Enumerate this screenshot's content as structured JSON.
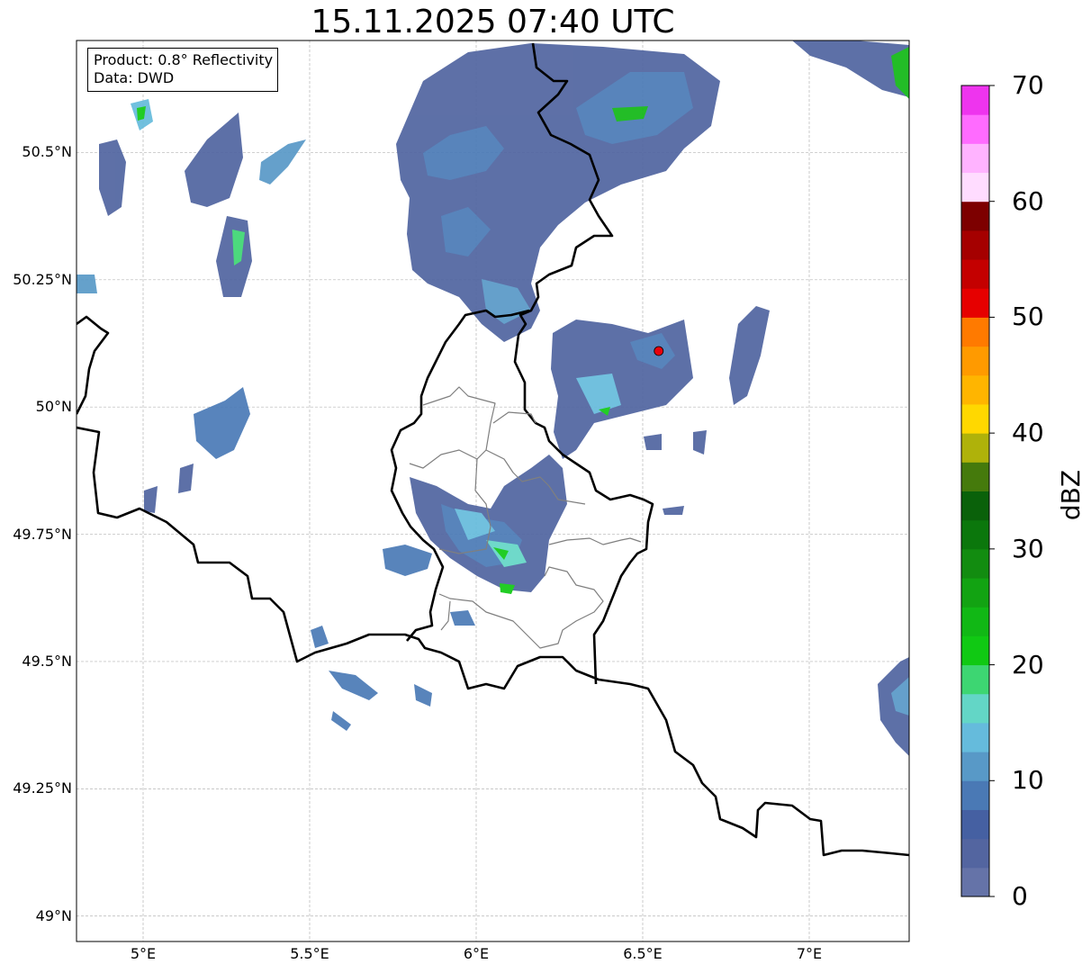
{
  "title": "15.11.2025 07:40 UTC",
  "info_box": {
    "product": "Product: 0.8° Reflectivity",
    "data": "Data: DWD"
  },
  "map": {
    "lon_range": [
      4.8,
      7.3
    ],
    "lat_range": [
      48.95,
      50.72
    ],
    "lat_ticks": [
      {
        "value": 49.0,
        "label": "49°N"
      },
      {
        "value": 49.25,
        "label": "49.25°N"
      },
      {
        "value": 49.5,
        "label": "49.5°N"
      },
      {
        "value": 49.75,
        "label": "49.75°N"
      },
      {
        "value": 50.0,
        "label": "50°N"
      },
      {
        "value": 50.25,
        "label": "50.25°N"
      },
      {
        "value": 50.5,
        "label": "50.5°N"
      }
    ],
    "lon_ticks": [
      {
        "value": 5.0,
        "label": "5°E"
      },
      {
        "value": 5.5,
        "label": "5.5°E"
      },
      {
        "value": 6.0,
        "label": "6°E"
      },
      {
        "value": 6.5,
        "label": "6.5°E"
      },
      {
        "value": 7.0,
        "label": "7°E"
      }
    ],
    "radar_site": {
      "lon": 6.548,
      "lat": 50.11,
      "color": "#e8000b"
    },
    "grid": true
  },
  "colorbar": {
    "label": "dBZ",
    "range": [
      0,
      70
    ],
    "ticks": [
      "0",
      "10",
      "20",
      "30",
      "40",
      "50",
      "60",
      "70"
    ],
    "colors": [
      "#6573a8",
      "#5365a0",
      "#4560a2",
      "#4a79b5",
      "#5899c7",
      "#65bbdc",
      "#63d6c6",
      "#3dd672",
      "#10c913",
      "#11b815",
      "#12a312",
      "#128c10",
      "#0b770c",
      "#0a610a",
      "#457a0c",
      "#afb20a",
      "#ffd800",
      "#ffb500",
      "#ff9a00",
      "#ff7a00",
      "#e60000",
      "#c40000",
      "#a50000",
      "#7d0000",
      "#ffdcff",
      "#ffb3ff",
      "#ff6bff",
      "#ee34ee"
    ]
  }
}
